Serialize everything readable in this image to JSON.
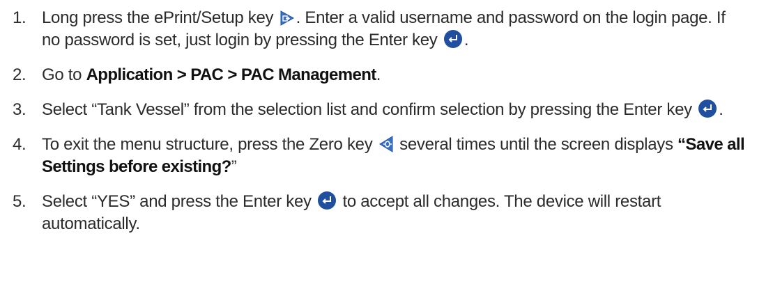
{
  "steps": [
    {
      "number": "1.",
      "text_a": "Long press the ePrint/Setup key ",
      "key_icon": "eprint-setup-key-icon",
      "text_b": ". Enter a valid username and password on the login page. If no password is set, just login by pressing the Enter key ",
      "key_icon_2": "enter-key-icon",
      "text_c": "."
    },
    {
      "number": "2.",
      "text_a": "Go to ",
      "bold": "Application > PAC > PAC Management",
      "text_b": "."
    },
    {
      "number": "3.",
      "text_a": "Select “Tank Vessel” from the selection list and confirm selection by pressing the Enter key ",
      "key_icon": "enter-key-icon",
      "text_b": "."
    },
    {
      "number": "4.",
      "text_a": "To exit the menu structure, press the Zero key ",
      "key_icon": "zero-key-icon",
      "text_b": " several times until the screen displays ",
      "quote_open": "“",
      "bold": "Save all Settings before existing?",
      "quote_close": "”"
    },
    {
      "number": "5.",
      "text_a": "Select “YES” and press the Enter key ",
      "key_icon": "enter-key-icon",
      "text_b": " to accept all changes. The device will restart automatically."
    }
  ],
  "colors": {
    "text": "#2b2b2b",
    "key_blue": "#1f4f9e",
    "key_fill_light": "#3b6fc2"
  }
}
